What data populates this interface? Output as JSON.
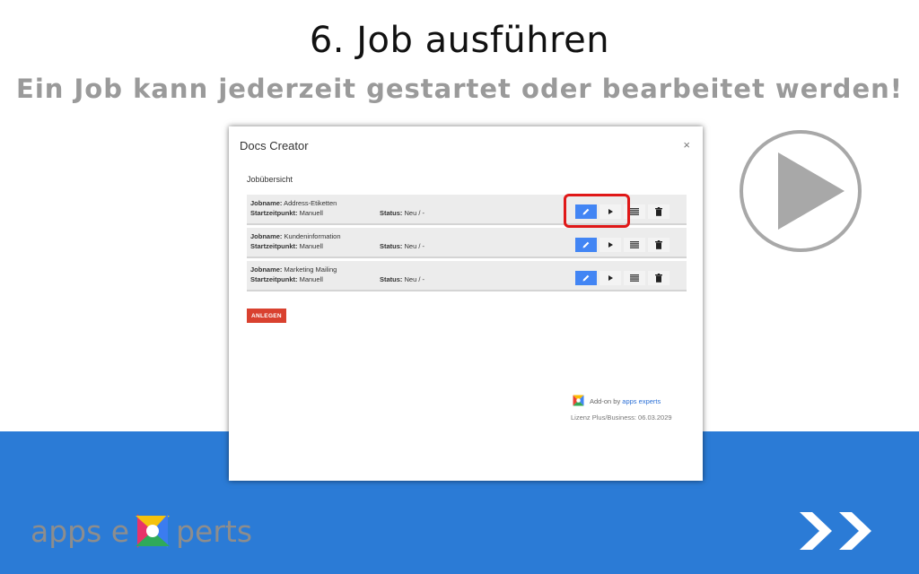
{
  "slide": {
    "title": "6. Job ausführen",
    "subtitle": "Ein Job kann jederzeit gestartet oder bearbeitet werden!"
  },
  "dialog": {
    "title": "Docs Creator",
    "close_glyph": "×",
    "section_label": "Jobübersicht",
    "jobs": [
      {
        "name_label": "Jobname:",
        "name": "Address-Etiketten",
        "start_label": "Startzeitpunkt:",
        "start": "Manuell",
        "status_label": "Status:",
        "status": "Neu / -"
      },
      {
        "name_label": "Jobname:",
        "name": "Kundeninformation",
        "start_label": "Startzeitpunkt:",
        "start": "Manuell",
        "status_label": "Status:",
        "status": "Neu / -"
      },
      {
        "name_label": "Jobname:",
        "name": "Marketing Mailing",
        "start_label": "Startzeitpunkt:",
        "start": "Manuell",
        "status_label": "Status:",
        "status": "Neu / -"
      }
    ],
    "create_button": "ANLEGEN",
    "addon_prefix": "Add-on by",
    "addon_link": "apps experts",
    "license": "Lizenz Plus/Business: 06.03.2029"
  },
  "brand": {
    "logo_left": "apps e",
    "logo_right": "perts"
  },
  "icons": {
    "edit": "pencil-icon",
    "run": "play-icon",
    "log": "list-icon",
    "delete": "trash-icon",
    "play_large": "play-circle-icon",
    "next": "double-chevron-right-icon"
  },
  "colors": {
    "band": "#2b7bd6",
    "edit_button": "#4285f4",
    "create_button": "#d9412f",
    "highlight": "#e01818",
    "subtitle": "#9a9a9a"
  }
}
